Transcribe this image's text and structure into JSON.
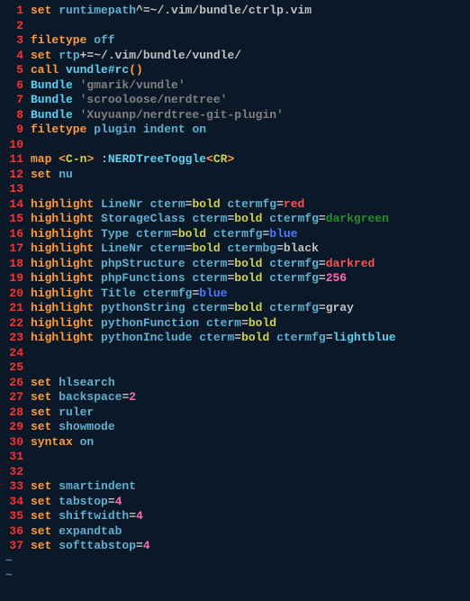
{
  "lines": [
    {
      "n": 1,
      "t": [
        [
          "set ",
          "keyword"
        ],
        [
          "runtimepath",
          "ident"
        ],
        [
          "^=",
          "op"
        ],
        [
          "~/.vim/bundle/ctrlp.vim",
          "path"
        ]
      ]
    },
    {
      "n": 2,
      "t": []
    },
    {
      "n": 3,
      "t": [
        [
          "filetype ",
          "keyword"
        ],
        [
          "off",
          "ident"
        ]
      ]
    },
    {
      "n": 4,
      "t": [
        [
          "set ",
          "keyword"
        ],
        [
          "rtp",
          "ident"
        ],
        [
          "+=",
          "op"
        ],
        [
          "~/.vim/bundle/vundle/",
          "path"
        ]
      ]
    },
    {
      "n": 5,
      "t": [
        [
          "call ",
          "keyword"
        ],
        [
          "vundle#rc",
          "func"
        ],
        [
          "()",
          "paren"
        ]
      ]
    },
    {
      "n": 6,
      "t": [
        [
          "Bundle ",
          "func"
        ],
        [
          "'gmarik/vundle'",
          "str"
        ]
      ]
    },
    {
      "n": 7,
      "t": [
        [
          "Bundle ",
          "func"
        ],
        [
          "'scrooloose/nerdtree'",
          "str"
        ]
      ]
    },
    {
      "n": 8,
      "t": [
        [
          "Bundle ",
          "func"
        ],
        [
          "'Xuyuanp/nerdtree-git-plugin'",
          "str"
        ]
      ]
    },
    {
      "n": 9,
      "t": [
        [
          "filetype ",
          "keyword"
        ],
        [
          "plugin ",
          "ident"
        ],
        [
          "indent ",
          "ident"
        ],
        [
          "on",
          "ident"
        ]
      ]
    },
    {
      "n": 10,
      "t": []
    },
    {
      "n": 11,
      "t": [
        [
          "map ",
          "keyword"
        ],
        [
          "<",
          "key"
        ],
        [
          "C-n",
          "const"
        ],
        [
          "> ",
          "key"
        ],
        [
          ":",
          "plain"
        ],
        [
          "NERDTreeToggle",
          "func"
        ],
        [
          "<",
          "key"
        ],
        [
          "CR",
          "const"
        ],
        [
          ">",
          "key"
        ]
      ]
    },
    {
      "n": 12,
      "t": [
        [
          "set ",
          "keyword"
        ],
        [
          "nu",
          "ident"
        ]
      ]
    },
    {
      "n": 13,
      "t": []
    },
    {
      "n": 14,
      "t": [
        [
          "highlight ",
          "keyword"
        ],
        [
          "LineNr ",
          "ident"
        ],
        [
          "cterm",
          "ident"
        ],
        [
          "=",
          "op"
        ],
        [
          "bold ",
          "const"
        ],
        [
          "ctermfg",
          "ident"
        ],
        [
          "=",
          "op"
        ],
        [
          "red",
          "red"
        ]
      ]
    },
    {
      "n": 15,
      "t": [
        [
          "highlight ",
          "keyword"
        ],
        [
          "StorageClass ",
          "ident"
        ],
        [
          "cterm",
          "ident"
        ],
        [
          "=",
          "op"
        ],
        [
          "bold ",
          "const"
        ],
        [
          "ctermfg",
          "ident"
        ],
        [
          "=",
          "op"
        ],
        [
          "darkgreen",
          "green"
        ]
      ]
    },
    {
      "n": 16,
      "t": [
        [
          "highlight ",
          "keyword"
        ],
        [
          "Type ",
          "ident"
        ],
        [
          "cterm",
          "ident"
        ],
        [
          "=",
          "op"
        ],
        [
          "bold ",
          "const"
        ],
        [
          "ctermfg",
          "ident"
        ],
        [
          "=",
          "op"
        ],
        [
          "blue",
          "blue"
        ]
      ]
    },
    {
      "n": 17,
      "t": [
        [
          "highlight ",
          "keyword"
        ],
        [
          "LineNr ",
          "ident"
        ],
        [
          "cterm",
          "ident"
        ],
        [
          "=",
          "op"
        ],
        [
          "bold ",
          "const"
        ],
        [
          "ctermbg",
          "ident"
        ],
        [
          "=",
          "op"
        ],
        [
          "black",
          "plain"
        ]
      ]
    },
    {
      "n": 18,
      "t": [
        [
          "highlight ",
          "keyword"
        ],
        [
          "phpStructure ",
          "ident"
        ],
        [
          "cterm",
          "ident"
        ],
        [
          "=",
          "op"
        ],
        [
          "bold ",
          "const"
        ],
        [
          "ctermfg",
          "ident"
        ],
        [
          "=",
          "op"
        ],
        [
          "darkred",
          "red"
        ]
      ]
    },
    {
      "n": 19,
      "t": [
        [
          "highlight ",
          "keyword"
        ],
        [
          "phpFunctions ",
          "ident"
        ],
        [
          "cterm",
          "ident"
        ],
        [
          "=",
          "op"
        ],
        [
          "bold ",
          "const"
        ],
        [
          "ctermfg",
          "ident"
        ],
        [
          "=",
          "op"
        ],
        [
          "256",
          "num"
        ]
      ]
    },
    {
      "n": 20,
      "t": [
        [
          "highlight ",
          "keyword"
        ],
        [
          "Title ",
          "ident"
        ],
        [
          "ctermfg",
          "ident"
        ],
        [
          "=",
          "op"
        ],
        [
          "blue",
          "blue"
        ]
      ]
    },
    {
      "n": 21,
      "t": [
        [
          "highlight ",
          "keyword"
        ],
        [
          "pythonString ",
          "ident"
        ],
        [
          "cterm",
          "ident"
        ],
        [
          "=",
          "op"
        ],
        [
          "bold ",
          "const"
        ],
        [
          "ctermfg",
          "ident"
        ],
        [
          "=",
          "op"
        ],
        [
          "gray",
          "plain"
        ]
      ]
    },
    {
      "n": 22,
      "t": [
        [
          "highlight ",
          "keyword"
        ],
        [
          "pythonFunction ",
          "ident"
        ],
        [
          "cterm",
          "ident"
        ],
        [
          "=",
          "op"
        ],
        [
          "bold",
          "const"
        ]
      ]
    },
    {
      "n": 23,
      "t": [
        [
          "highlight ",
          "keyword"
        ],
        [
          "pythonInclude ",
          "ident"
        ],
        [
          "cterm",
          "ident"
        ],
        [
          "=",
          "op"
        ],
        [
          "bold ",
          "const"
        ],
        [
          "ctermfg",
          "ident"
        ],
        [
          "=",
          "op"
        ],
        [
          "lightblue",
          "func"
        ]
      ]
    },
    {
      "n": 24,
      "t": []
    },
    {
      "n": 25,
      "t": []
    },
    {
      "n": 26,
      "t": [
        [
          "set ",
          "keyword"
        ],
        [
          "hlsearch",
          "ident"
        ]
      ]
    },
    {
      "n": 27,
      "t": [
        [
          "set ",
          "keyword"
        ],
        [
          "backspace",
          "ident"
        ],
        [
          "=",
          "op"
        ],
        [
          "2",
          "num"
        ]
      ]
    },
    {
      "n": 28,
      "t": [
        [
          "set ",
          "keyword"
        ],
        [
          "ruler",
          "ident"
        ]
      ]
    },
    {
      "n": 29,
      "t": [
        [
          "set ",
          "keyword"
        ],
        [
          "showmode",
          "ident"
        ]
      ]
    },
    {
      "n": 30,
      "t": [
        [
          "syntax ",
          "keyword"
        ],
        [
          "on",
          "ident"
        ]
      ]
    },
    {
      "n": 31,
      "t": []
    },
    {
      "n": 32,
      "t": []
    },
    {
      "n": 33,
      "t": [
        [
          "set ",
          "keyword"
        ],
        [
          "smartindent",
          "ident"
        ]
      ]
    },
    {
      "n": 34,
      "t": [
        [
          "set ",
          "keyword"
        ],
        [
          "tabstop",
          "ident"
        ],
        [
          "=",
          "op"
        ],
        [
          "4",
          "num"
        ]
      ]
    },
    {
      "n": 35,
      "t": [
        [
          "set ",
          "keyword"
        ],
        [
          "shiftwidth",
          "ident"
        ],
        [
          "=",
          "op"
        ],
        [
          "4",
          "num"
        ]
      ]
    },
    {
      "n": 36,
      "t": [
        [
          "set ",
          "keyword"
        ],
        [
          "expandtab",
          "ident"
        ]
      ]
    },
    {
      "n": 37,
      "t": [
        [
          "set ",
          "keyword"
        ],
        [
          "softtabstop",
          "ident"
        ],
        [
          "=",
          "op"
        ],
        [
          "4",
          "num"
        ]
      ]
    }
  ],
  "tilde": "~",
  "tilde_count": 2
}
